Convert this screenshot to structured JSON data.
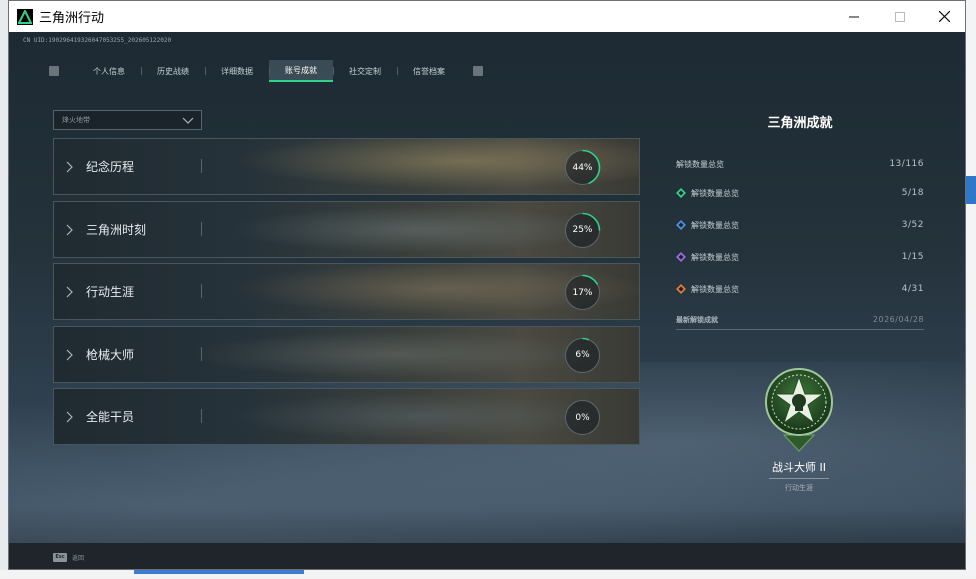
{
  "window": {
    "title": "三角洲行动",
    "uid": "CN UID:190296419326047053255_202605122020"
  },
  "tabs": {
    "items": [
      {
        "label": "个人信息"
      },
      {
        "label": "历史战绩"
      },
      {
        "label": "详细数据"
      },
      {
        "label": "账号成就"
      },
      {
        "label": "社交定制"
      },
      {
        "label": "信誉档案"
      }
    ],
    "active": "账号成就"
  },
  "filter": {
    "value": "烽火地带"
  },
  "categories": [
    {
      "label": "纪念历程",
      "progress": 44,
      "progress_text": "44%"
    },
    {
      "label": "三角洲时刻",
      "progress": 25,
      "progress_text": "25%"
    },
    {
      "label": "行动生涯",
      "progress": 17,
      "progress_text": "17%"
    },
    {
      "label": "枪械大师",
      "progress": 6,
      "progress_text": "6%"
    },
    {
      "label": "全能干员",
      "progress": 0,
      "progress_text": "0%"
    }
  ],
  "summary": {
    "title": "三角洲成就",
    "total": {
      "label": "解锁数量总览",
      "value": "13/116"
    },
    "rows": [
      {
        "label": "解锁数量总览",
        "value": "5/18",
        "icon": "green-tier-icon",
        "color": "#2fd28a"
      },
      {
        "label": "解锁数量总览",
        "value": "3/52",
        "icon": "blue-tier-icon",
        "color": "#4a8fe0"
      },
      {
        "label": "解锁数量总览",
        "value": "1/15",
        "icon": "purple-tier-icon",
        "color": "#9a6be0"
      },
      {
        "label": "解锁数量总览",
        "value": "4/31",
        "icon": "orange-tier-icon",
        "color": "#e07a3a"
      }
    ],
    "latest_label": "最新解锁成就",
    "latest_date": "2026/04/28"
  },
  "latest_badge": {
    "name": "战斗大师 II",
    "category": "行动生涯"
  },
  "footer": {
    "key": "Esc",
    "label": "返回"
  },
  "colors": {
    "accent": "#2fd28a"
  }
}
